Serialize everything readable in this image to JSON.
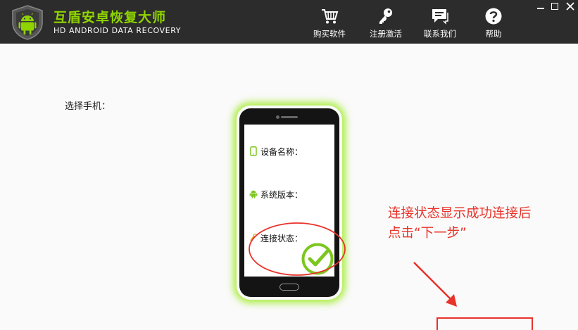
{
  "app": {
    "title": "互盾安卓恢复大师",
    "subtitle": "HD ANDROID DATA RECOVERY",
    "logo_icon": "android-shield-logo",
    "brand_color": "#8fd400"
  },
  "nav": {
    "buy": {
      "label": "购买软件",
      "icon": "cart-icon"
    },
    "register": {
      "label": "注册激活",
      "icon": "key-icon"
    },
    "contact": {
      "label": "联系我们",
      "icon": "chat-icon"
    },
    "help": {
      "label": "帮助",
      "icon": "help-icon"
    }
  },
  "main": {
    "select_phone_label": "选择手机：",
    "device_name_label": "设备名称：",
    "system_version_label": "系统版本：",
    "connection_status_label": "连接状态："
  },
  "annotation": {
    "line1": "连接状态显示成功连接后",
    "line2": "点击“下一步”",
    "color": "#e8332a"
  },
  "colors": {
    "header_bg": "#2c2c2c",
    "glow": "#a0eb28",
    "check": "#7cc620"
  }
}
